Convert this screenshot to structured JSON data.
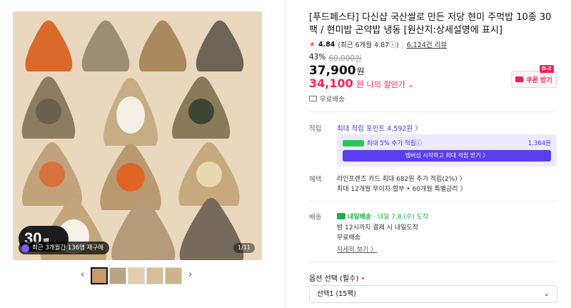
{
  "gallery": {
    "badge_number": "30",
    "badge_unit": "팩",
    "repurchase_text": "최근 3개월간 136명 재구매",
    "counter": "1/11",
    "thumbnails": [
      "thumb-1",
      "thumb-2",
      "thumb-3",
      "thumb-4",
      "thumb-5"
    ],
    "prev_icon": "chevron-left-icon",
    "next_icon": "chevron-right-icon"
  },
  "product": {
    "title": "[푸드페스타] 다신샵 국산쌀로 만든 저당 현미 주먹밥 10종 30팩 / 현미밥 곤약밥 냉동 [원산지:상세설명에 표시]",
    "rating": "4.84",
    "rating_recent": "(최근 6개월 4.87ⓘ)",
    "review_count": "6,124건 리뷰",
    "discount_pct": "43%",
    "original_price": "60,000원",
    "price": "37,900",
    "price_unit": "원",
    "my_price": "34,100",
    "my_price_unit": "원",
    "my_price_label": "나의 할인가 ⌄",
    "coupon_label": "쿠폰 받기",
    "coupon_dday": "D-2",
    "free_shipping_top": "무료배송"
  },
  "points": {
    "label": "적립",
    "max_points": "최대 적립 포인트 4,592원 〉",
    "membership_row_left": "최대 5% 추가 적립ⓘ",
    "membership_row_right": "1,364원",
    "membership_button": "멤버십 시작하고 최대 적립 받기 〉"
  },
  "benefits": {
    "label": "혜택",
    "line1": "라인프렌즈 카드 최대 682원 추가 적립(2%) 〉",
    "line2": "최대 12개월 무이자 할부 • 60개월 특별금리 〉"
  },
  "shipping": {
    "label": "배송",
    "badge": "내일배송",
    "date": "· 내일 7.8.(수) 도착",
    "line1": "밤 12시까지 결제 시 내일도착",
    "line2": "무료배송",
    "detail_link": "자세히 보기 〉"
  },
  "options": {
    "label": "옵션 선택 (필수)",
    "required_mark": "•",
    "selected": "선택1 (15팩)"
  },
  "colors": {
    "accent_red": "#ff1f4f",
    "membership_purple": "#5b3df0",
    "delivery_green": "#1bb24a"
  }
}
